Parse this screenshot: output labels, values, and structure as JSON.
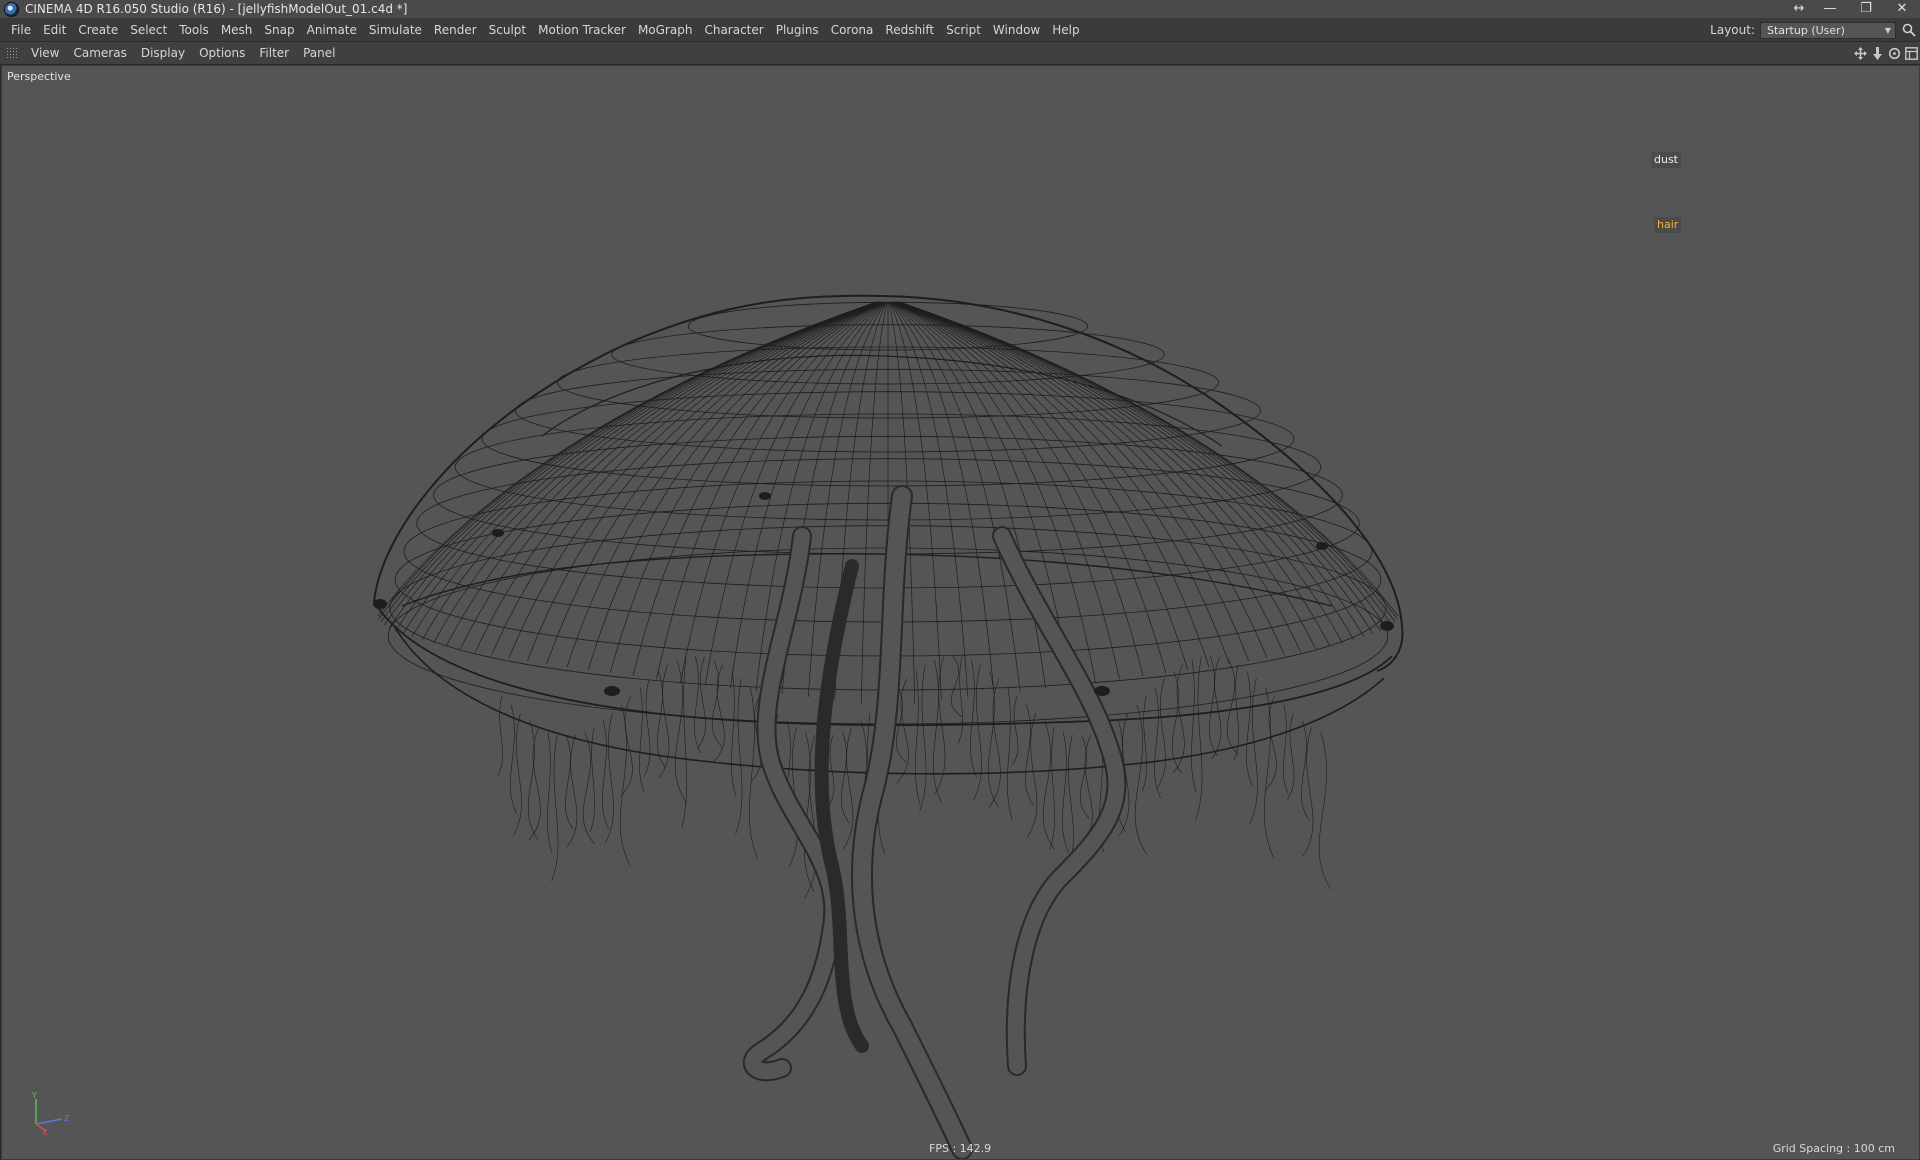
{
  "window": {
    "title": "CINEMA 4D R16.050 Studio (R16) - [jellyfishModelOut_01.c4d *]",
    "controls": [
      "↔",
      "—",
      "❐",
      "✕"
    ]
  },
  "menu": {
    "items": [
      "File",
      "Edit",
      "Create",
      "Select",
      "Tools",
      "Mesh",
      "Snap",
      "Animate",
      "Simulate",
      "Render",
      "Sculpt",
      "Motion Tracker",
      "MoGraph",
      "Character",
      "Plugins",
      "Corona",
      "Redshift",
      "Script",
      "Window",
      "Help"
    ],
    "layout_label": "Layout:",
    "layout_value": "Startup (User)"
  },
  "viewport_menu": {
    "items": [
      "View",
      "Cameras",
      "Display",
      "Options",
      "Filter",
      "Panel"
    ]
  },
  "viewport": {
    "name": "Perspective",
    "tags": {
      "dust": "dust",
      "hair": "hair"
    },
    "fps": "FPS : 142.9",
    "grid_spacing": "Grid Spacing : 100 cm",
    "background_color": "#555555",
    "wire_color": "#1e1e1e",
    "hair_tag_color": "#f2b23a"
  },
  "axis": {
    "y": "Y",
    "z": "Z",
    "x": "X"
  }
}
